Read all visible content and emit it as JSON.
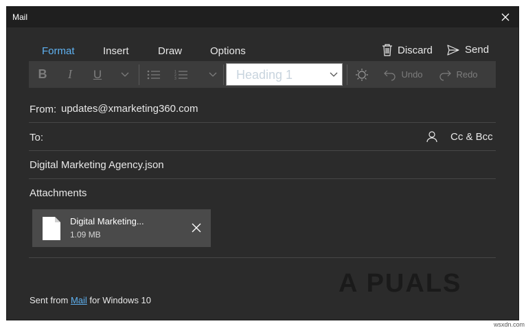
{
  "window": {
    "title": "Mail"
  },
  "tabs": [
    {
      "label": "Format",
      "active": true
    },
    {
      "label": "Insert",
      "active": false
    },
    {
      "label": "Draw",
      "active": false
    },
    {
      "label": "Options",
      "active": false
    }
  ],
  "actions": {
    "discard_label": "Discard",
    "send_label": "Send"
  },
  "toolbar": {
    "style_value": "Heading 1",
    "undo_label": "Undo",
    "redo_label": "Redo"
  },
  "from": {
    "label": "From:",
    "value": "updates@xmarketing360.com"
  },
  "to": {
    "label": "To:",
    "cc_bcc_label": "Cc & Bcc"
  },
  "subject": {
    "value": "Digital Marketing Agency.json"
  },
  "attachments": {
    "label": "Attachments",
    "items": [
      {
        "name": "Digital Marketing...",
        "size": "1.09 MB"
      }
    ]
  },
  "footer": {
    "prefix": "Sent from ",
    "link": "Mail",
    "suffix": " for Windows 10"
  },
  "watermark": {
    "text": "A PUALS",
    "site": "wsxdn.com"
  },
  "colors": {
    "accent": "#5fb2f2",
    "background": "#2b2b2b",
    "toolbar": "#3c3c3c"
  }
}
